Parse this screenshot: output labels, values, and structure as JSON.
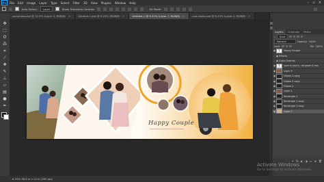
{
  "menu": {
    "logo": "Ps",
    "items": [
      "File",
      "Edit",
      "Image",
      "Layer",
      "Type",
      "Select",
      "Filter",
      "3D",
      "View",
      "Plugins",
      "Window",
      "Help"
    ]
  },
  "options": {
    "auto_select": "Auto-Select:",
    "auto_select_target": "Layer",
    "transform": "Show Transform Controls",
    "mode_3d": "3D Mode:"
  },
  "tabs": [
    {
      "label": "psd photo.psd @ 12.5% (Layer 0, RGB/8)",
      "active": false
    },
    {
      "label": "Untitled-1.psd @ 6.25% (RGB/8)",
      "active": false
    },
    {
      "label": "Untitled-1 @ 8.33% (Layer 7, RGB/8)",
      "active": true
    },
    {
      "label": "psd photo.psd @ 6.25% (Layer 0, RGB/8)",
      "active": false
    }
  ],
  "document": {
    "title_text": "Happy Couple",
    "accent": "#f0a020"
  },
  "status": {
    "text": "8.33%    36.6 in x 12 in (300 ppi)"
  },
  "panels": {
    "tabs": [
      "Layers",
      "Channels",
      "Paths"
    ],
    "filter_kind": "Kind",
    "blend_mode": "Normal",
    "opacity_label": "Opacity:",
    "opacity_value": "100%",
    "lock_label": "Lock:",
    "fill_label": "Fill:",
    "fill_value": "100%",
    "layers": [
      {
        "name": "Happy Couple",
        "kind": "text"
      },
      {
        "name": "Effects",
        "kind": "effects"
      },
      {
        "name": "Color Overlay",
        "kind": "effect"
      },
      {
        "name": "Love is just a...nd grow & rea",
        "kind": "text"
      },
      {
        "name": "Layer 9",
        "kind": "pixel"
      },
      {
        "name": "Ellipse 2 copy",
        "kind": "shape"
      },
      {
        "name": "Ellipse 2 copy",
        "kind": "shape"
      },
      {
        "name": "Ellipse 2",
        "kind": "shape"
      },
      {
        "name": "Layer 1",
        "kind": "pixel"
      },
      {
        "name": "Rectangle 1",
        "kind": "shape"
      },
      {
        "name": "Rectangle 1 copy",
        "kind": "shape"
      },
      {
        "name": "Rectangle 1 copy",
        "kind": "shape"
      },
      {
        "name": "Layer 7",
        "kind": "pixel"
      }
    ]
  },
  "watermark": {
    "line1": "Activate Windows",
    "line2": "Go to Settings to activate Windows."
  }
}
